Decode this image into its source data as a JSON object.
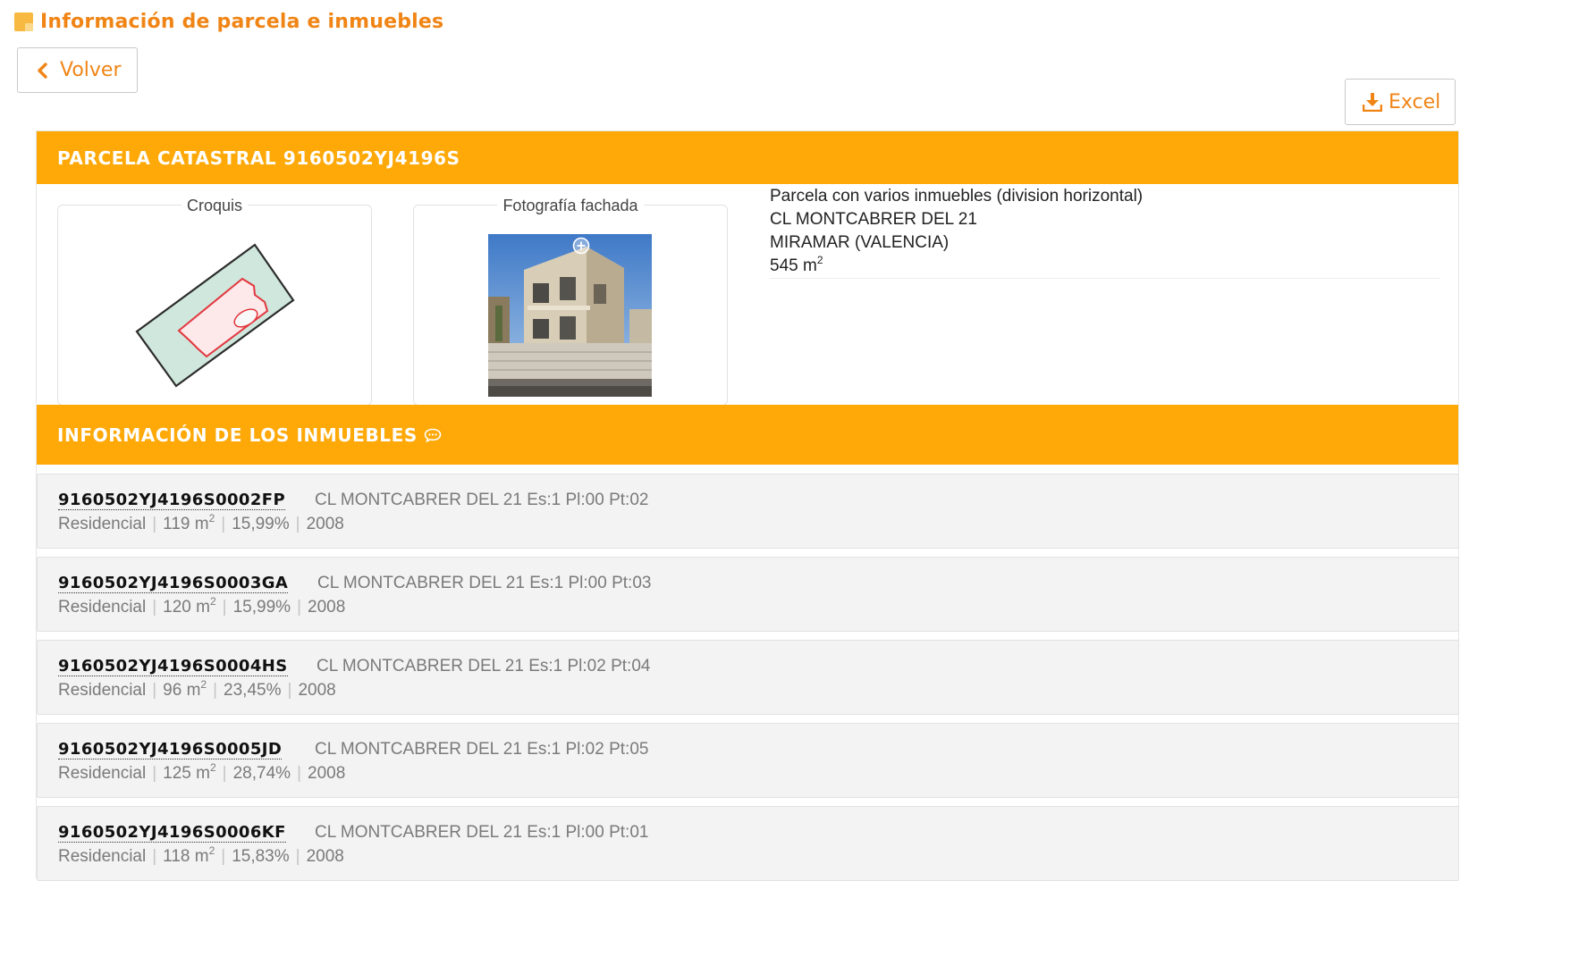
{
  "page": {
    "title": "Información de parcela e inmuebles"
  },
  "toolbar": {
    "back_label": "Volver",
    "excel_label": "Excel"
  },
  "colors": {
    "accent": "#fea908",
    "link": "#f08516"
  },
  "icons": {
    "header": "parcel-icon",
    "back": "chevron-left-icon",
    "excel": "download-icon",
    "info": "chat-bubble-icon",
    "zoom": "zoom-plus-icon"
  },
  "parcel": {
    "header": "PARCELA CATASTRAL 9160502YJ4196S",
    "croquis_label": "Croquis",
    "foto_label": "Fotografía fachada",
    "type": "Parcela con varios inmuebles (division horizontal)",
    "address": "CL MONTCABRER DEL 21",
    "town": "MIRAMAR (VALENCIA)",
    "area_value": "545 m",
    "area_unit_sup": "2"
  },
  "inmuebles": {
    "header": "INFORMACIÓN DE LOS INMUEBLES",
    "items": [
      {
        "ref": "9160502YJ4196S0002FP",
        "address": "CL MONTCABRER DEL 21 Es:1 Pl:00 Pt:02",
        "use": "Residencial",
        "area": "119 m",
        "area_sup": "2",
        "share": "15,99%",
        "year": "2008"
      },
      {
        "ref": "9160502YJ4196S0003GA",
        "address": "CL MONTCABRER DEL 21 Es:1 Pl:00 Pt:03",
        "use": "Residencial",
        "area": "120 m",
        "area_sup": "2",
        "share": "15,99%",
        "year": "2008"
      },
      {
        "ref": "9160502YJ4196S0004HS",
        "address": "CL MONTCABRER DEL 21 Es:1 Pl:02 Pt:04",
        "use": "Residencial",
        "area": "96 m",
        "area_sup": "2",
        "share": "23,45%",
        "year": "2008"
      },
      {
        "ref": "9160502YJ4196S0005JD",
        "address": "CL MONTCABRER DEL 21 Es:1 Pl:02 Pt:05",
        "use": "Residencial",
        "area": "125 m",
        "area_sup": "2",
        "share": "28,74%",
        "year": "2008"
      },
      {
        "ref": "9160502YJ4196S0006KF",
        "address": "CL MONTCABRER DEL 21 Es:1 Pl:00 Pt:01",
        "use": "Residencial",
        "area": "118 m",
        "area_sup": "2",
        "share": "15,83%",
        "year": "2008"
      }
    ]
  }
}
